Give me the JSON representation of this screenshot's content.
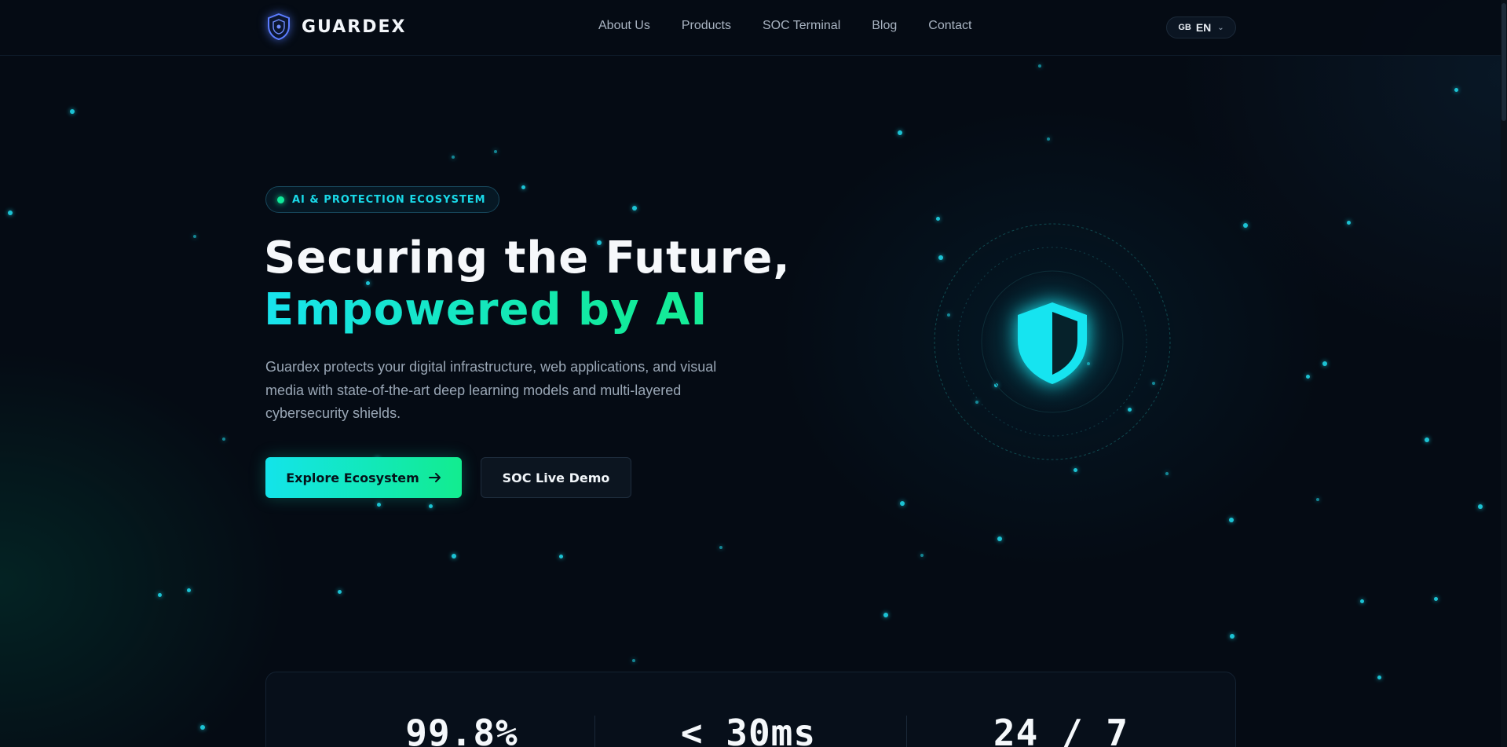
{
  "nav": {
    "brand": "GUARDEX",
    "links": [
      "About Us",
      "Products",
      "SOC Terminal",
      "Blog",
      "Contact"
    ],
    "language": {
      "flag": "GB",
      "code": "EN"
    }
  },
  "hero": {
    "badge": "AI & PROTECTION ECOSYSTEM",
    "title_line1": "Securing the Future,",
    "title_line2": "Empowered by AI",
    "description": "Guardex protects your digital infrastructure, web applications, and visual media with state-of-the-art deep learning models and multi-layered cybersecurity shields.",
    "primary_button": "Explore Ecosystem",
    "secondary_button": "SOC Live Demo"
  },
  "stats": [
    "99.8%",
    "< 30ms",
    "24 / 7"
  ],
  "colors": {
    "accent_cyan": "#18e3ee",
    "accent_green": "#12ea9c",
    "background": "#050b14"
  }
}
